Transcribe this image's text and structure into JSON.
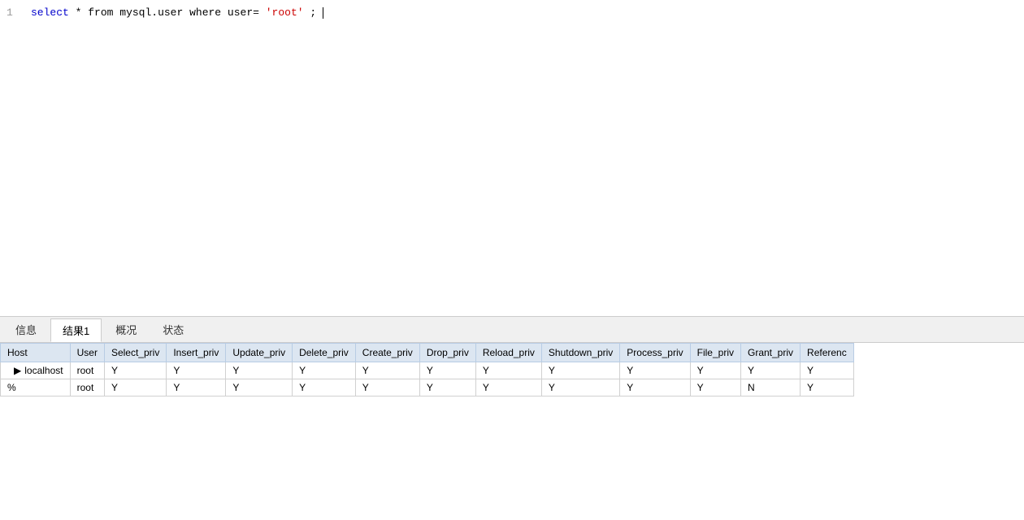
{
  "editor": {
    "lines": [
      {
        "number": "1",
        "tokens": [
          {
            "text": "select",
            "type": "keyword"
          },
          {
            "text": " * ",
            "type": "plain"
          },
          {
            "text": "from",
            "type": "plain"
          },
          {
            "text": " mysql.user ",
            "type": "plain"
          },
          {
            "text": "where",
            "type": "plain"
          },
          {
            "text": " user=",
            "type": "plain"
          },
          {
            "text": "'root'",
            "type": "string"
          },
          {
            "text": ";",
            "type": "plain"
          }
        ]
      }
    ]
  },
  "tabs": [
    {
      "id": "info",
      "label": "信息",
      "active": false
    },
    {
      "id": "result1",
      "label": "结果1",
      "active": true
    },
    {
      "id": "overview",
      "label": "概况",
      "active": false
    },
    {
      "id": "status",
      "label": "状态",
      "active": false
    }
  ],
  "table": {
    "columns": [
      "Host",
      "User",
      "Select_priv",
      "Insert_priv",
      "Update_priv",
      "Delete_priv",
      "Create_priv",
      "Drop_priv",
      "Reload_priv",
      "Shutdown_priv",
      "Process_priv",
      "File_priv",
      "Grant_priv",
      "Referenc"
    ],
    "rows": [
      {
        "indicator": true,
        "cells": [
          "localhost",
          "root",
          "Y",
          "Y",
          "Y",
          "Y",
          "Y",
          "Y",
          "Y",
          "Y",
          "Y",
          "Y",
          "Y",
          "Y"
        ]
      },
      {
        "indicator": false,
        "cells": [
          "%",
          "root",
          "Y",
          "Y",
          "Y",
          "Y",
          "Y",
          "Y",
          "Y",
          "Y",
          "Y",
          "Y",
          "N",
          "Y"
        ]
      }
    ]
  }
}
